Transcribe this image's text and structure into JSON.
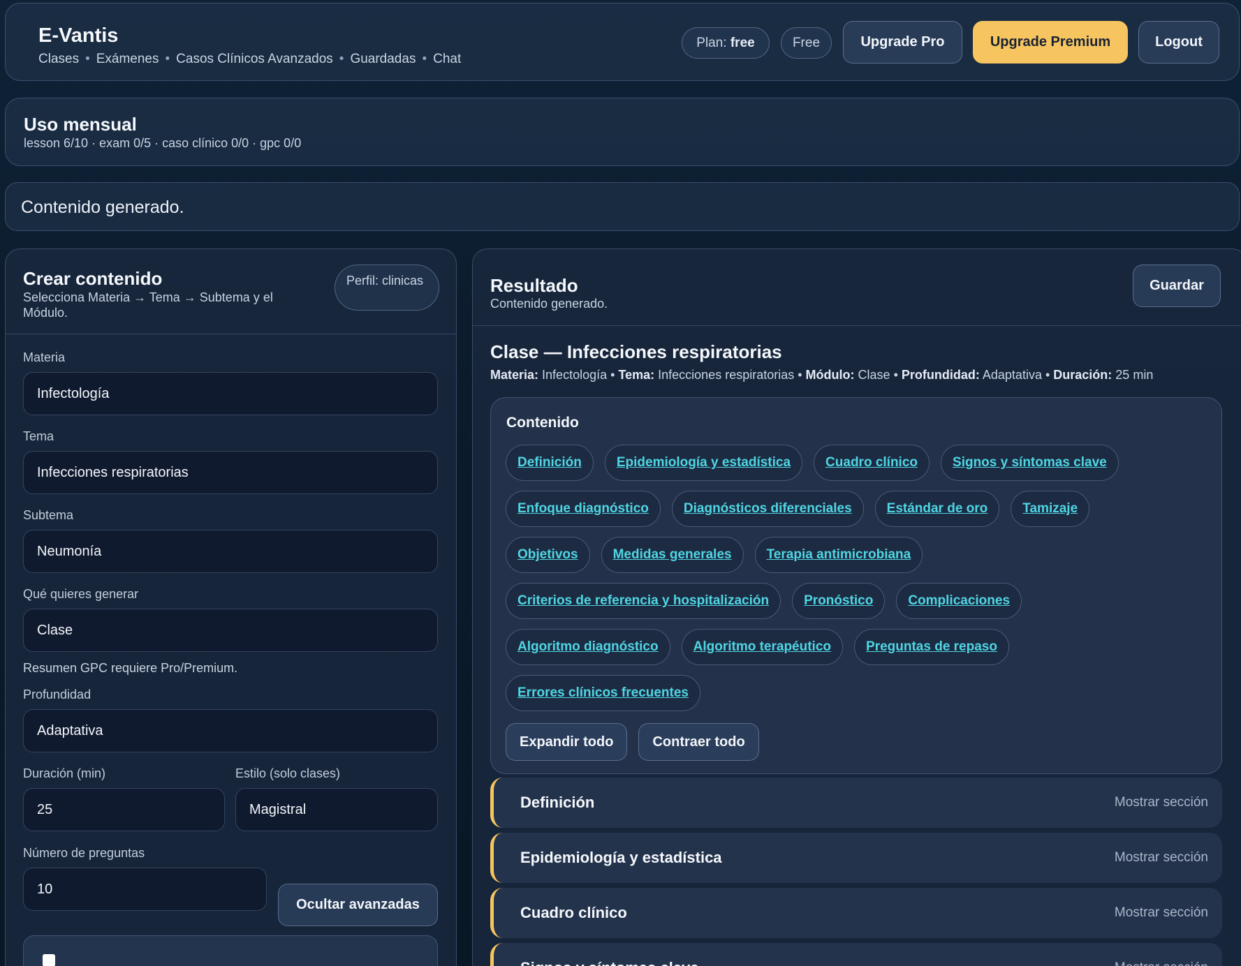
{
  "header": {
    "brand": "E-Vantis",
    "nav": [
      "Clases",
      "Exámenes",
      "Casos Clínicos Avanzados",
      "Guardadas",
      "Chat"
    ],
    "plan_label": "Plan:",
    "plan_value": "free",
    "free_badge": "Free",
    "upgrade_pro": "Upgrade Pro",
    "upgrade_premium": "Upgrade Premium",
    "logout": "Logout"
  },
  "usage": {
    "title": "Uso mensual",
    "text": "lesson 6/10 · exam 0/5 · caso clínico 0/0 · gpc 0/0"
  },
  "status": {
    "message": "Contenido generado."
  },
  "create": {
    "title": "Crear contenido",
    "subtitle": "Selecciona Materia → Tema → Subtema y el Módulo.",
    "perfil": "Perfil: clinicas",
    "materia_label": "Materia",
    "materia_value": "Infectología",
    "tema_label": "Tema",
    "tema_value": "Infecciones respiratorias",
    "subtema_label": "Subtema",
    "subtema_value": "Neumonía",
    "generar_label": "Qué quieres generar",
    "generar_value": "Clase",
    "gpc_note": "Resumen GPC requiere Pro/Premium.",
    "profundidad_label": "Profundidad",
    "profundidad_value": "Adaptativa",
    "duracion_label": "Duración (min)",
    "duracion_value": "25",
    "estilo_label": "Estilo (solo clases)",
    "estilo_value": "Magistral",
    "preguntas_label": "Número de preguntas",
    "preguntas_value": "10",
    "ocultar_avanzadas": "Ocultar avanzadas"
  },
  "result": {
    "title": "Resultado",
    "subtitle": "Contenido generado.",
    "guardar": "Guardar",
    "heading": "Clase — Infecciones respiratorias",
    "meta": {
      "materia_k": "Materia:",
      "materia_v": "Infectología",
      "tema_k": "Tema:",
      "tema_v": "Infecciones respiratorias",
      "modulo_k": "Módulo:",
      "modulo_v": "Clase",
      "prof_k": "Profundidad:",
      "prof_v": "Adaptativa",
      "dur_k": "Duración:",
      "dur_v": "25 min"
    },
    "contenido_title": "Contenido",
    "chip_rows": [
      [
        "Definición",
        "Epidemiología y estadística",
        "Cuadro clínico",
        "Signos y síntomas clave"
      ],
      [
        "Enfoque diagnóstico",
        "Diagnósticos diferenciales",
        "Estándar de oro",
        "Tamizaje"
      ],
      [
        "Objetivos",
        "Medidas generales",
        "Terapia antimicrobiana"
      ],
      [
        "Criterios de referencia y hospitalización",
        "Pronóstico",
        "Complicaciones"
      ],
      [
        "Algoritmo diagnóstico",
        "Algoritmo terapéutico",
        "Preguntas de repaso"
      ],
      [
        "Errores clínicos frecuentes"
      ]
    ],
    "expandir": "Expandir todo",
    "contraer": "Contraer todo",
    "sections": [
      {
        "title": "Definición",
        "action": "Mostrar sección"
      },
      {
        "title": "Epidemiología y estadística",
        "action": "Mostrar sección"
      },
      {
        "title": "Cuadro clínico",
        "action": "Mostrar sección"
      },
      {
        "title": "Signos y síntomas clave",
        "action": "Mostrar sección"
      }
    ]
  },
  "colors": {
    "accent_gold": "#f6c560",
    "link_cyan": "#4fd6e3",
    "background": "#0b1b2c"
  }
}
